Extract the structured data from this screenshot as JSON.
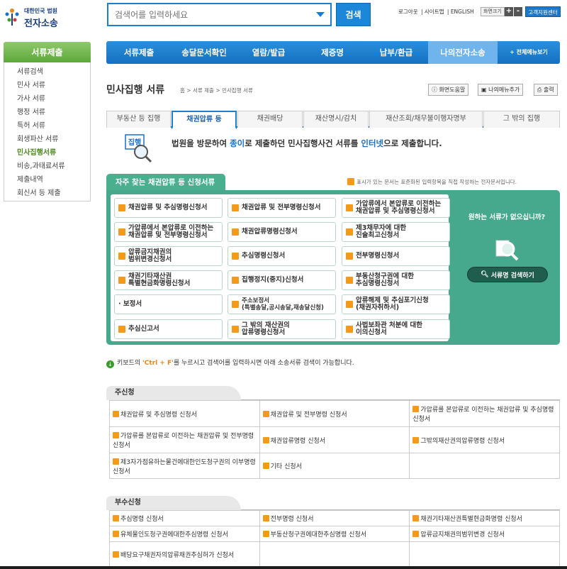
{
  "header": {
    "logo_top": "대한민국 법원",
    "logo_main": "전자소송",
    "search": {
      "placeholder": "검색어를 입력하세요",
      "button": "검색"
    },
    "util": {
      "logout": "로그아웃",
      "sitemap": "사이트맵",
      "english": "ENGLISH",
      "font_size": "화면크기",
      "plus": "+",
      "minus": "-",
      "support": "고객지원센터"
    }
  },
  "sidebar": {
    "title": "서류제출",
    "items": [
      "서류검색",
      "민사 서류",
      "가사 서류",
      "행정 서류",
      "특허 서류",
      "회생파산 서류",
      "민사집행서류",
      "비송,과태료서류",
      "제출내역",
      "회신서 등 제출"
    ]
  },
  "gnb": [
    "서류제출",
    "송달문서확인",
    "열람/발급",
    "제증명",
    "납부/환급",
    "나의전자소송",
    "+ 전체메뉴보기"
  ],
  "page": {
    "title": "민사집행 서류",
    "breadcrumb": "홈 > 서류 제출 > 민사집행 서류",
    "buttons": [
      "화면도움말",
      "나의메뉴추가",
      "출력"
    ]
  },
  "tabs": [
    "부동산 등 집행",
    "채권압류 등",
    "채권배당",
    "재산명시/감치",
    "재산조회/채무불이행자명부",
    "그 밖의 집행"
  ],
  "intro": {
    "icon_label": "집행",
    "p1": "법원을 방문하여 ",
    "p2": "종이",
    "p3": "로 제출하던 민사집행사건 서류를 ",
    "p4": "인터넷",
    "p5": "으로 제출합니다."
  },
  "panel": {
    "title": "자주 찾는 채권압류 등 신청서류",
    "legend": "표시가 있는 문서는 표준화된 입력항목을 직접 작성하는 전자문서입니다.",
    "cells": [
      [
        "채권압류 및 추심명령신청서"
      ],
      [
        "채권압류 및 전부명령신청서"
      ],
      [
        "가압류에서 본압류로 이전하는",
        "채권압류 및 추심명령신청서"
      ],
      [
        "가압류에서 본압류로 이전하는",
        "채권압류 및 전부명령신청서"
      ],
      [
        "채권압류명령신청서"
      ],
      [
        "제3채무자에 대한",
        "진술최고신청서"
      ],
      [
        "압류금지채권의",
        "범위변경신청서"
      ],
      [
        "추심명령신청서"
      ],
      [
        "전부명령신청서"
      ],
      [
        "채권기타재산권",
        "특별현금화명령신청서"
      ],
      [
        "집행정지(중지)신청서"
      ],
      [
        "부동산청구권에 대한",
        "추심명령신청서"
      ],
      [
        "· 보정서"
      ],
      [
        "주소보정서",
        "(특별송달,공시송달,재송달신청)"
      ],
      [
        "압류해제 및 추심포기신청",
        "(채권자취하서)"
      ],
      [
        "추심신고서"
      ],
      [
        "그 밖의 재산권의",
        "압류명령신청서"
      ],
      [
        "사법보좌관 처분에 대한",
        "이의신청서"
      ]
    ],
    "not_found": "원하는 서류가 없으십니까?",
    "find_button": "서류명 검색하기"
  },
  "tip": {
    "p1": "키보드의 ",
    "keys": "'Ctrl + F'",
    "p2": "를 누르시고 검색어를 입력하시면 아래 소송서류 검색이 가능합니다."
  },
  "main_section": {
    "title": "주신청",
    "rows": [
      [
        "채권압류 및 추심명령 신청서",
        "채권압류 및 전부명령 신청서",
        "가압류를 본압류로 이전하는 채권압류 및 추심명령 신청서"
      ],
      [
        "가압류를 본압류로 이전하는 채권압류 및 전부명령 신청서",
        "채권압류명령 신청서",
        "그밖의재산권의압류명령 신청서"
      ],
      [
        "제3자가점유하는물건에대한인도청구권의 이부명령 신청서",
        "기타 신청서",
        ""
      ]
    ]
  },
  "sub_section": {
    "title": "부수신청",
    "rows": [
      [
        "추심명령 신청서",
        "전부명령 신청서",
        "채권기타재산권특별현금화명령 신청서"
      ],
      [
        "유체물인도청구권에대한추심명령 신청서",
        "부동산청구권에대한추심명령 신청서",
        "압류금지채권의범위변경 신청서"
      ],
      [
        "배당요구채권자의압류채권추심허가 신청서",
        "",
        ""
      ]
    ]
  }
}
